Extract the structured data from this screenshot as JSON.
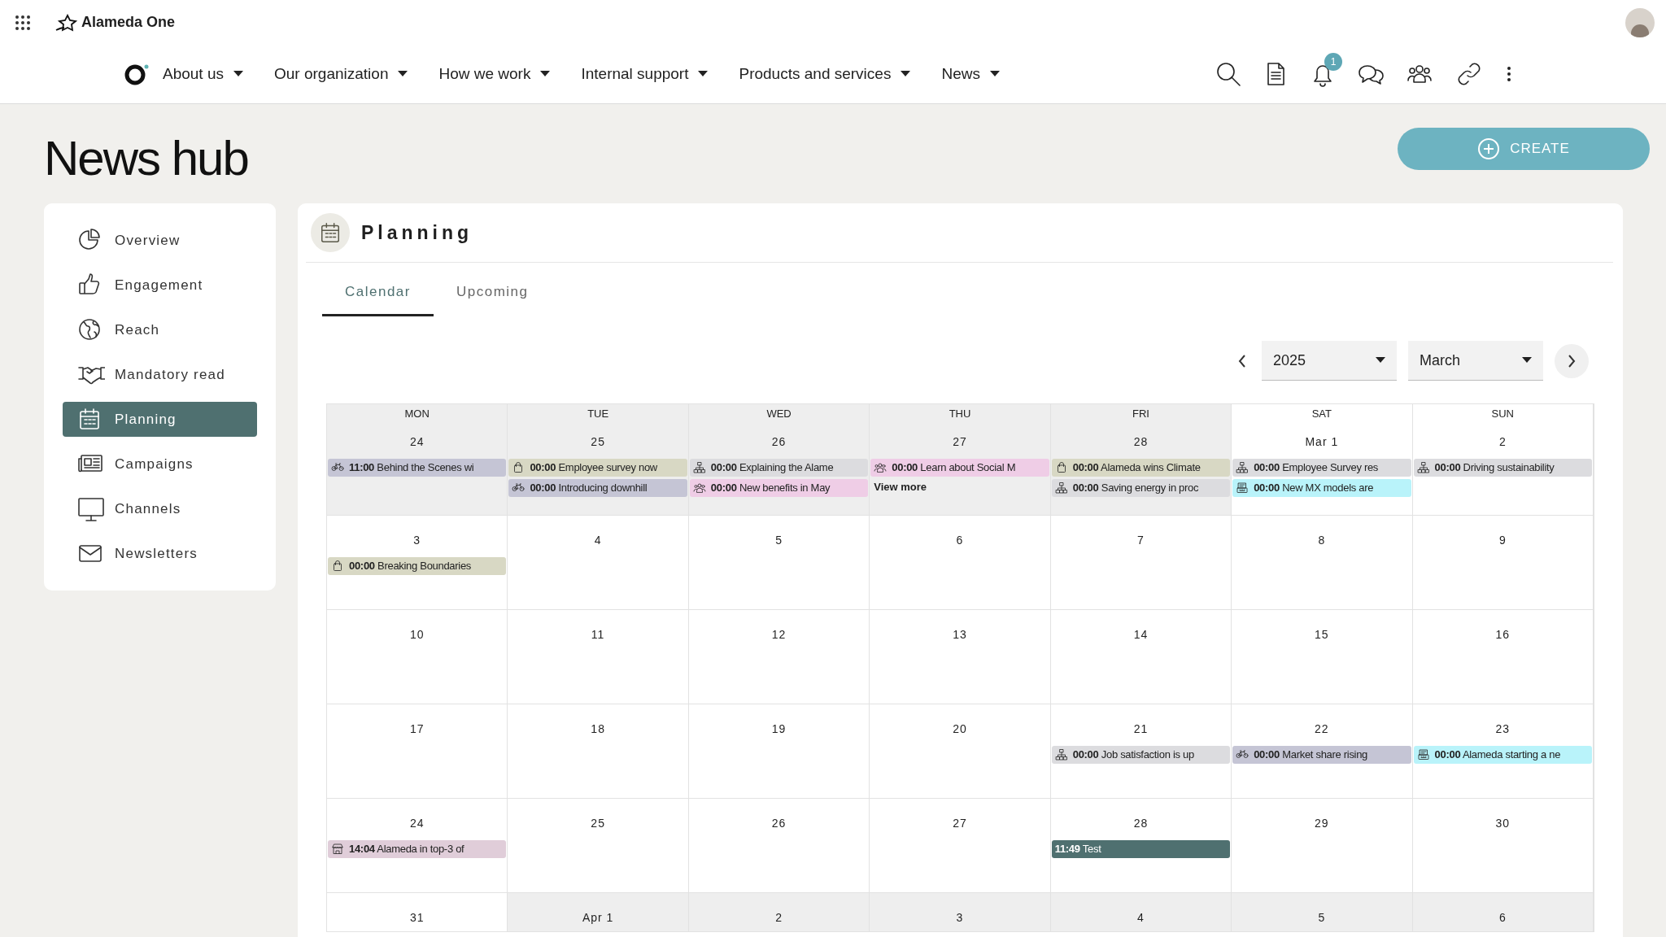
{
  "topbar": {
    "brand": "Alameda One"
  },
  "nav": [
    {
      "label": "About us"
    },
    {
      "label": "Our organization"
    },
    {
      "label": "How we work"
    },
    {
      "label": "Internal support"
    },
    {
      "label": "Products and services"
    },
    {
      "label": "News"
    }
  ],
  "notifications_badge": "1",
  "page_title": "News hub",
  "create_button": "CREATE",
  "sidebar": {
    "items": [
      {
        "label": "Overview",
        "selected": false
      },
      {
        "label": "Engagement",
        "selected": false
      },
      {
        "label": "Reach",
        "selected": false
      },
      {
        "label": "Mandatory read",
        "selected": false
      },
      {
        "label": "Planning",
        "selected": true
      },
      {
        "label": "Campaigns",
        "selected": false
      },
      {
        "label": "Channels",
        "selected": false
      },
      {
        "label": "Newsletters",
        "selected": false
      }
    ]
  },
  "panel": {
    "title": "Planning",
    "tabs": [
      {
        "label": "Calendar",
        "selected": true
      },
      {
        "label": "Upcoming",
        "selected": false
      }
    ],
    "year": "2025",
    "month": "March",
    "weekdays": [
      "MON",
      "TUE",
      "WED",
      "THU",
      "FRI",
      "SAT",
      "SUN"
    ],
    "weeks": [
      {
        "days": [
          {
            "date": "24",
            "in_month": false,
            "events": [
              {
                "time": "11:00",
                "title": "Behind the Scenes wi",
                "kind": "bike",
                "color": "#c5c5d5"
              }
            ]
          },
          {
            "date": "25",
            "in_month": false,
            "events": [
              {
                "time": "00:00",
                "title": "Employee survey now",
                "kind": "bag",
                "color": "#d8d8c4"
              },
              {
                "time": "00:00",
                "title": "Introducing downhill",
                "kind": "bike",
                "color": "#c5c5d5"
              }
            ]
          },
          {
            "date": "26",
            "in_month": false,
            "events": [
              {
                "time": "00:00",
                "title": "Explaining the Alame",
                "kind": "org",
                "color": "#dcdcdf"
              },
              {
                "time": "00:00",
                "title": "New benefits in May",
                "kind": "people",
                "color": "#efcde6"
              }
            ]
          },
          {
            "date": "27",
            "in_month": false,
            "events": [
              {
                "time": "00:00",
                "title": "Learn about Social M",
                "kind": "people",
                "color": "#efcde6"
              }
            ],
            "more": "View more"
          },
          {
            "date": "28",
            "in_month": false,
            "events": [
              {
                "time": "00:00",
                "title": "Alameda wins Climate",
                "kind": "bag",
                "color": "#d8d8c4"
              },
              {
                "time": "00:00",
                "title": "Saving energy in proc",
                "kind": "org",
                "color": "#dcdcdf"
              }
            ]
          },
          {
            "date": "Mar 1",
            "in_month": true,
            "events": [
              {
                "time": "00:00",
                "title": "Employee Survey res",
                "kind": "org",
                "color": "#dcdcdf"
              },
              {
                "time": "00:00",
                "title": "New MX models are",
                "kind": "register",
                "color": "#b9f3fa"
              }
            ]
          },
          {
            "date": "2",
            "in_month": true,
            "events": [
              {
                "time": "00:00",
                "title": "Driving sustainability",
                "kind": "org",
                "color": "#dcdcdf"
              }
            ]
          }
        ]
      },
      {
        "days": [
          {
            "date": "3",
            "in_month": true,
            "events": [
              {
                "time": "00:00",
                "title": "Breaking Boundaries",
                "kind": "bag",
                "color": "#d8d8c4"
              }
            ]
          },
          {
            "date": "4",
            "in_month": true
          },
          {
            "date": "5",
            "in_month": true
          },
          {
            "date": "6",
            "in_month": true
          },
          {
            "date": "7",
            "in_month": true
          },
          {
            "date": "8",
            "in_month": true
          },
          {
            "date": "9",
            "in_month": true
          }
        ]
      },
      {
        "days": [
          {
            "date": "10",
            "in_month": true
          },
          {
            "date": "11",
            "in_month": true
          },
          {
            "date": "12",
            "in_month": true
          },
          {
            "date": "13",
            "in_month": true
          },
          {
            "date": "14",
            "in_month": true
          },
          {
            "date": "15",
            "in_month": true
          },
          {
            "date": "16",
            "in_month": true
          }
        ]
      },
      {
        "days": [
          {
            "date": "17",
            "in_month": true
          },
          {
            "date": "18",
            "in_month": true
          },
          {
            "date": "19",
            "in_month": true
          },
          {
            "date": "20",
            "in_month": true
          },
          {
            "date": "21",
            "in_month": true,
            "events": [
              {
                "time": "00:00",
                "title": "Job satisfaction is up",
                "kind": "org",
                "color": "#dcdcdf"
              }
            ]
          },
          {
            "date": "22",
            "in_month": true,
            "events": [
              {
                "time": "00:00",
                "title": "Market share rising",
                "kind": "bike",
                "color": "#c5c5d5"
              }
            ]
          },
          {
            "date": "23",
            "in_month": true,
            "events": [
              {
                "time": "00:00",
                "title": "Alameda starting a ne",
                "kind": "register",
                "color": "#b9f3fa"
              }
            ]
          }
        ]
      },
      {
        "days": [
          {
            "date": "24",
            "in_month": true,
            "events": [
              {
                "time": "14:04",
                "title": "Alameda in top-3 of",
                "kind": "store",
                "color": "#e0cdd9"
              }
            ]
          },
          {
            "date": "25",
            "in_month": true
          },
          {
            "date": "26",
            "in_month": true
          },
          {
            "date": "27",
            "in_month": true
          },
          {
            "date": "28",
            "in_month": true,
            "events": [
              {
                "time": "11:49",
                "title": "Test",
                "kind": "plain",
                "color": "#4f7070"
              }
            ]
          },
          {
            "date": "29",
            "in_month": true
          },
          {
            "date": "30",
            "in_month": true
          }
        ]
      },
      {
        "days": [
          {
            "date": "31",
            "in_month": true
          },
          {
            "date": "Apr 1",
            "in_month": false
          },
          {
            "date": "2",
            "in_month": false
          },
          {
            "date": "3",
            "in_month": false
          },
          {
            "date": "4",
            "in_month": false
          },
          {
            "date": "5",
            "in_month": false
          },
          {
            "date": "6",
            "in_month": false
          }
        ]
      }
    ]
  }
}
